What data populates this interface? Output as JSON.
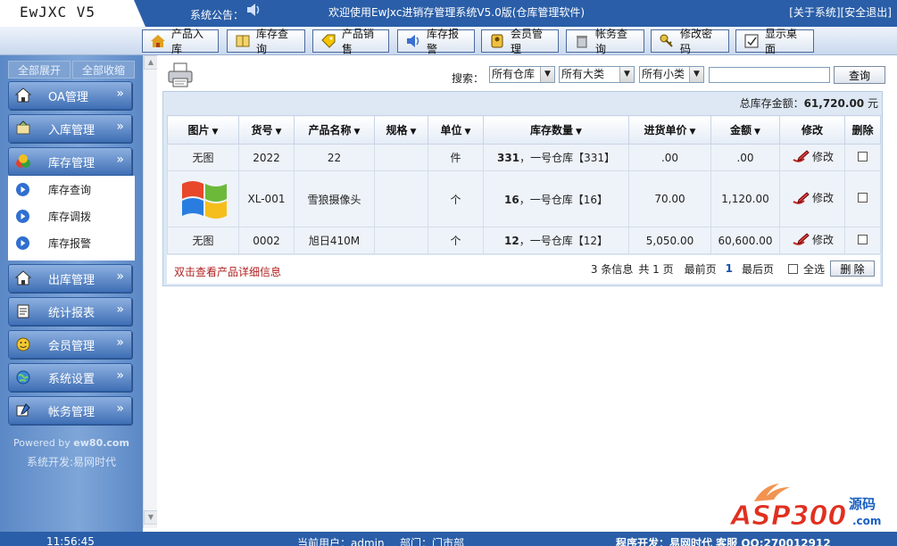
{
  "header": {
    "logo": "EwJXC V5",
    "notice_label": "系统公告：",
    "welcome": "欢迎使用EwJxc进销存管理系统V5.0版(仓库管理软件)",
    "about": "[关于系统]",
    "logout": "[安全退出]"
  },
  "nav": [
    {
      "label": "产品入库",
      "icon": "house-icon"
    },
    {
      "label": "库存查询",
      "icon": "book-icon"
    },
    {
      "label": "产品销售",
      "icon": "tag-icon"
    },
    {
      "label": "库存报警",
      "icon": "speaker-icon"
    },
    {
      "label": "会员管理",
      "icon": "id-card-icon"
    },
    {
      "label": "帐务查询",
      "icon": "trash-icon"
    },
    {
      "label": "修改密码",
      "icon": "key-icon"
    },
    {
      "label": "显示桌面",
      "icon": "desktop-icon"
    }
  ],
  "sidebar": {
    "expand_all": "全部展开",
    "collapse_all": "全部收缩",
    "menus": [
      {
        "label": "OA管理"
      },
      {
        "label": "入库管理"
      },
      {
        "label": "库存管理"
      },
      {
        "label": "出库管理"
      },
      {
        "label": "统计报表"
      },
      {
        "label": "会员管理"
      },
      {
        "label": "系统设置"
      },
      {
        "label": "帐务管理"
      }
    ],
    "submenu": [
      {
        "label": "库存查询"
      },
      {
        "label": "库存调拨"
      },
      {
        "label": "库存报警"
      }
    ],
    "powered_prefix": "Powered by ",
    "powered_site": "ew80.com",
    "developer": "系统开发:易网时代"
  },
  "search": {
    "label": "搜索：",
    "warehouse": "所有仓库",
    "category": "所有大类",
    "subcategory": "所有小类",
    "keyword": "",
    "button": "查询"
  },
  "summary": {
    "label": "总库存金额：",
    "value": "61,720.00",
    "unit": "元"
  },
  "table": {
    "headers": [
      "图片",
      "货号",
      "产品名称",
      "规格",
      "单位",
      "库存数量",
      "进货单价",
      "金额",
      "修改",
      "删除"
    ],
    "rows": [
      {
        "image": "无图",
        "code": "2022",
        "name": "22",
        "spec": "",
        "unit": "件",
        "qty": "331",
        "stock": "，一号仓库【331】",
        "price": ".00",
        "amount": ".00",
        "edit": "修改"
      },
      {
        "image": "",
        "code": "XL-001",
        "name": "雪狼摄像头",
        "spec": "",
        "unit": "个",
        "qty": "16",
        "stock": "，一号仓库【16】",
        "price": "70.00",
        "amount": "1,120.00",
        "edit": "修改"
      },
      {
        "image": "无图",
        "code": "0002",
        "name": "旭日410M",
        "spec": "",
        "unit": "个",
        "qty": "12",
        "stock": "，一号仓库【12】",
        "price": "5,050.00",
        "amount": "60,600.00",
        "edit": "修改"
      }
    ]
  },
  "footer": {
    "hint": "双击查看产品详细信息",
    "count": "3 条信息",
    "pages": "共 1 页",
    "first": "最前页",
    "current": "1",
    "last": "最后页",
    "select_all": "全选",
    "delete": "删 除"
  },
  "statusbar": {
    "time": "11:56:45",
    "user": "当前用户：admin",
    "dept": "部门：门市部",
    "dev": "程序开发：易网时代 客服 QQ:270012912"
  },
  "watermark": "ASP300源码 .com",
  "colors": {
    "header_bg": "#2a5ea8",
    "sidebar_bg": "#6f98d0",
    "hint_red": "#b02020"
  }
}
